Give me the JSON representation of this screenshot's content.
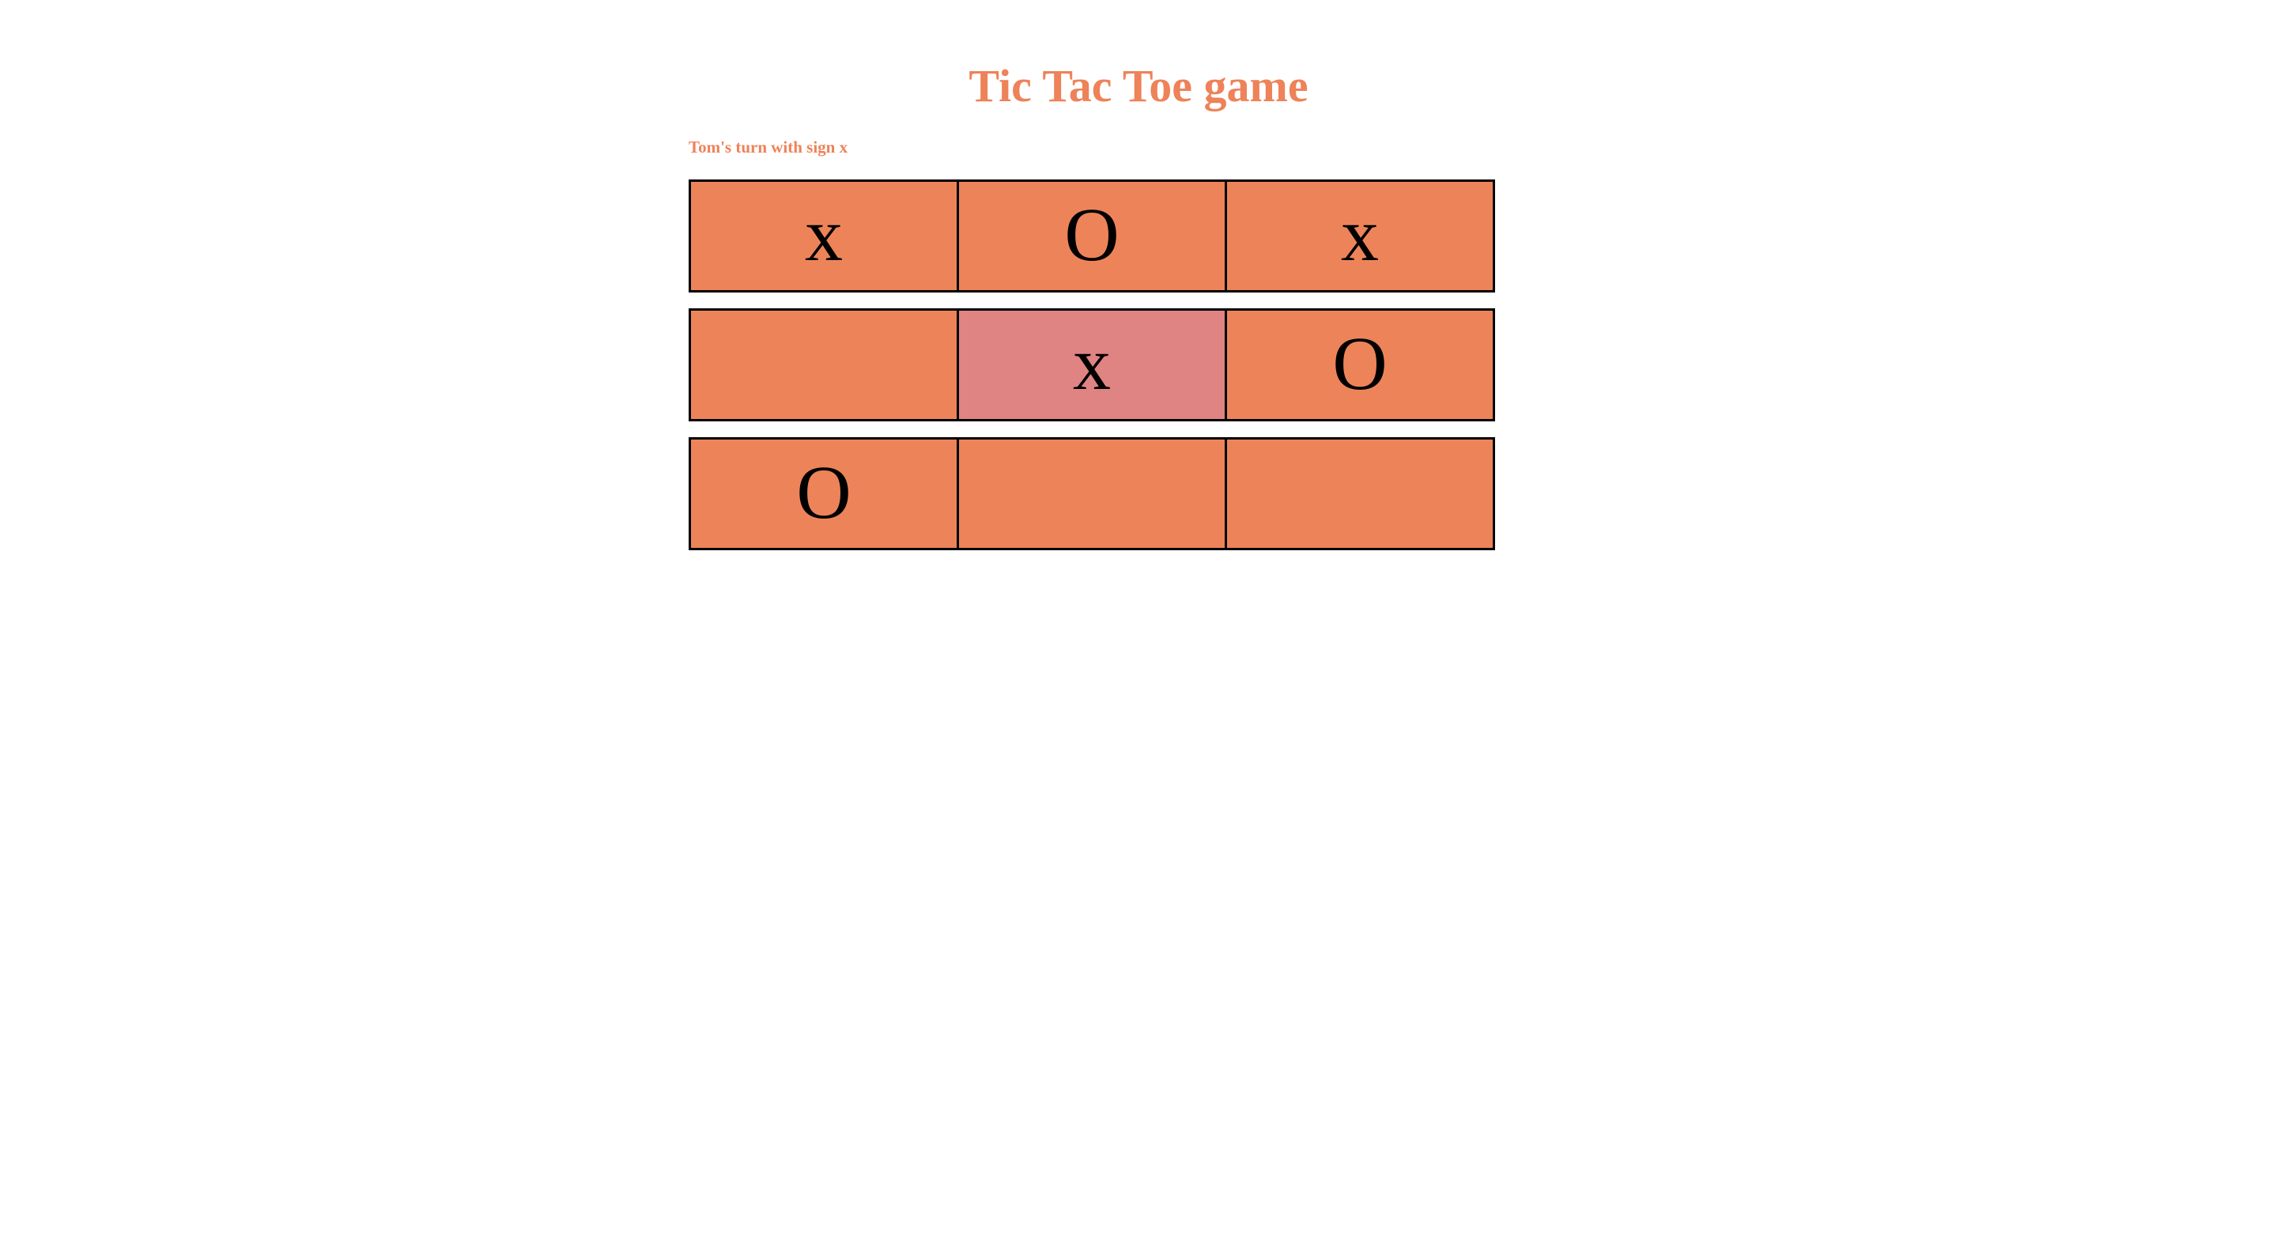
{
  "page": {
    "title": "Tic Tac Toe game",
    "background_color": "#ffffff"
  },
  "status": {
    "text": "Tom's turn with sign x",
    "color": "#ee8259"
  },
  "theme": {
    "accent_color": "#ee8259",
    "cell_color": "#ed8459",
    "cell_highlight_color": "#e08383",
    "border_color": "#000000",
    "mark_color": "#000000"
  },
  "board": {
    "rows": [
      {
        "cells": [
          {
            "mark": "x",
            "highlighted": false,
            "name": "cell-0-0"
          },
          {
            "mark": "O",
            "highlighted": false,
            "name": "cell-0-1"
          },
          {
            "mark": "x",
            "highlighted": false,
            "name": "cell-0-2"
          }
        ]
      },
      {
        "cells": [
          {
            "mark": "",
            "highlighted": false,
            "name": "cell-1-0"
          },
          {
            "mark": "x",
            "highlighted": true,
            "name": "cell-1-1"
          },
          {
            "mark": "O",
            "highlighted": false,
            "name": "cell-1-2"
          }
        ]
      },
      {
        "cells": [
          {
            "mark": "O",
            "highlighted": false,
            "name": "cell-2-0"
          },
          {
            "mark": "",
            "highlighted": false,
            "name": "cell-2-1"
          },
          {
            "mark": "",
            "highlighted": false,
            "name": "cell-2-2"
          }
        ]
      }
    ]
  },
  "game": {
    "current_player": "Tom",
    "current_sign": "x"
  }
}
